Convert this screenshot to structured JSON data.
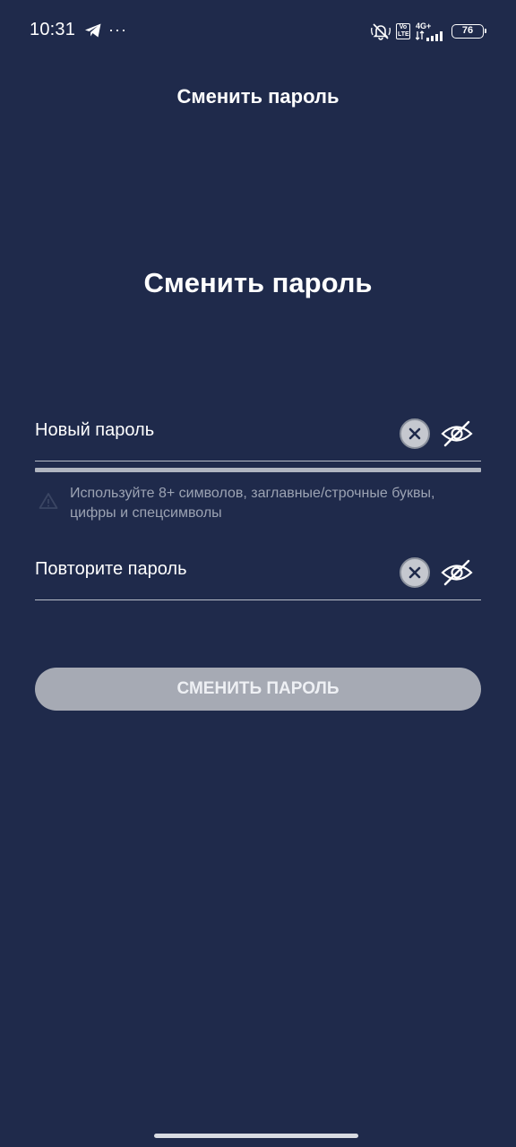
{
  "status_bar": {
    "time": "10:31",
    "network_label": "4G+",
    "volte_label": "Vo LTE",
    "battery_level": "76",
    "icons": [
      "telegram-icon",
      "more-dots-icon",
      "muted-bell-icon",
      "volte-icon",
      "signal-icon",
      "battery-icon"
    ]
  },
  "header": {
    "title": "Сменить пароль"
  },
  "main": {
    "heading": "Сменить пароль",
    "new_password": {
      "placeholder": "Новый пароль",
      "value": ""
    },
    "hint": "Используйте 8+ символов, заглавные/строчные буквы, цифры и спецсимволы",
    "repeat_password": {
      "placeholder": "Повторите пароль",
      "value": ""
    },
    "submit_label": "СМЕНИТЬ ПАРОЛЬ"
  },
  "colors": {
    "background": "#1f2a4b",
    "button_disabled": "#a6aab4",
    "hint_text": "#9ca3b3",
    "underline": "#b8bdc8"
  }
}
